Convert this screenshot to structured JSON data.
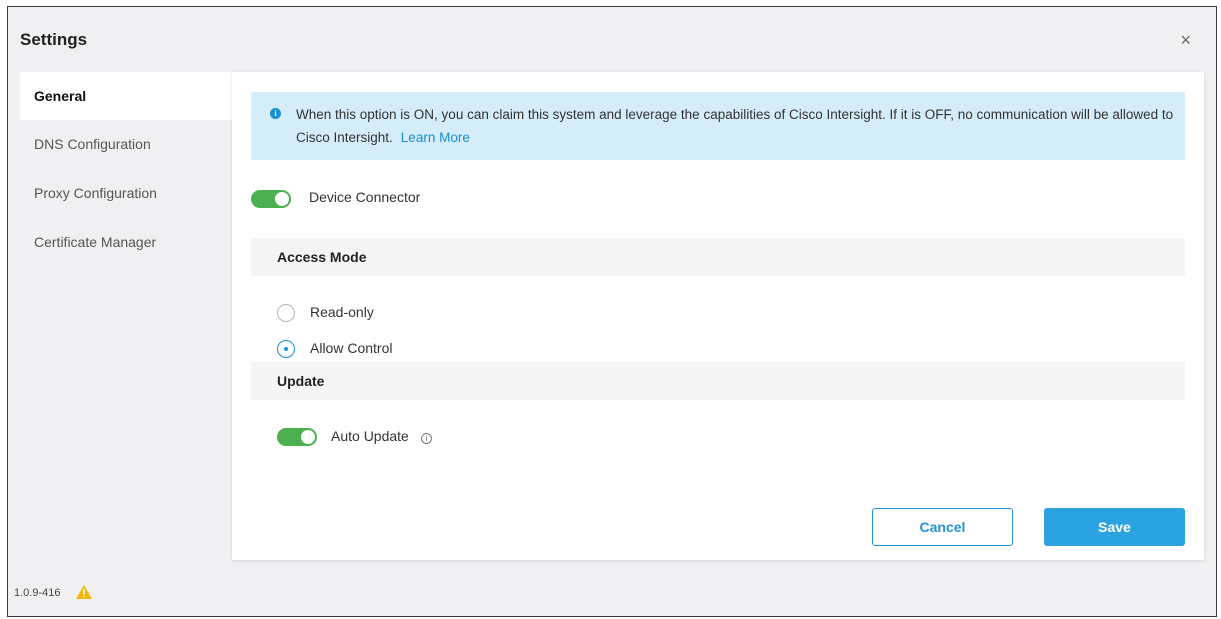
{
  "dialog": {
    "title": "Settings",
    "close_glyph": "×"
  },
  "sidebar": {
    "items": [
      {
        "label": "General",
        "active": true
      },
      {
        "label": "DNS Configuration",
        "active": false
      },
      {
        "label": "Proxy Configuration",
        "active": false
      },
      {
        "label": "Certificate Manager",
        "active": false
      }
    ]
  },
  "banner": {
    "icon": "info-icon",
    "text": "When this option is ON, you can claim this system and leverage the capabilities of Cisco Intersight. If it is OFF, no communication will be allowed to Cisco Intersight.",
    "link": "Learn More"
  },
  "device_connector": {
    "label": "Device Connector",
    "enabled": true
  },
  "access_mode": {
    "title": "Access Mode",
    "options": [
      {
        "label": "Read-only",
        "selected": false
      },
      {
        "label": "Allow Control",
        "selected": true
      }
    ]
  },
  "update": {
    "title": "Update",
    "auto_update_label": "Auto Update",
    "auto_update_enabled": true
  },
  "actions": {
    "cancel_label": "Cancel",
    "save_label": "Save"
  },
  "footer": {
    "version": "1.0.9-416",
    "warning_icon": "warning-icon"
  },
  "colors": {
    "accent": "#2aa3e0",
    "toggle_on": "#4caf50",
    "banner_bg": "#d4edf9",
    "warning": "#f5b800"
  }
}
